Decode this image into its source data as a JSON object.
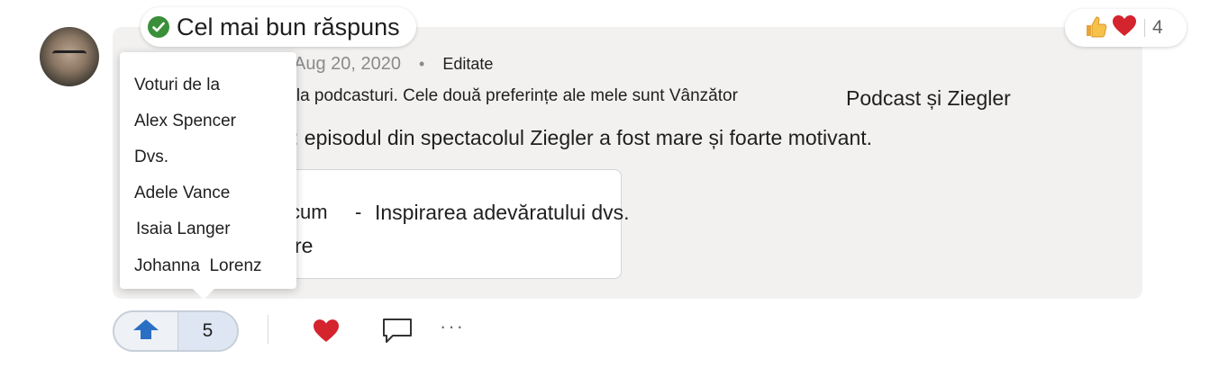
{
  "post": {
    "best_answer_label": "Cel mai bun răspuns",
    "date": "Aug 20, 2020",
    "separator": "•",
    "edited_label": "Editate",
    "body_line1_part1": "g  la podcasturi. Cele două preferințe ale mele sunt Vânzător",
    "body_line1_part2": "Podcast și Ziegler",
    "body_line2": ": episodul din spectacolul Ziegler a fost mare și foarte motivant.",
    "link_card": {
      "fragment1": "cum",
      "dash": "-",
      "title": "Inspirarea adevăratului dvs.",
      "fragment2": "re"
    }
  },
  "reactions": {
    "count": "4",
    "icons": [
      "thumbs-up-icon",
      "heart-icon"
    ]
  },
  "voters_popup": {
    "header": "Voturi de la",
    "names": [
      "Alex Spencer",
      "Dvs.",
      "Adele Vance",
      "Isaia Langer",
      "Johanna  Lorenz"
    ]
  },
  "vote": {
    "count": "5",
    "icon": "upvote-arrow-icon"
  },
  "actions": {
    "like_icon": "heart-icon",
    "reply_icon": "comment-icon",
    "more_label": "···"
  },
  "colors": {
    "accent_blue": "#2b6fc4",
    "heart_red": "#d4242e",
    "check_green": "#3a8f3a",
    "card_bg": "#f2f1f0"
  }
}
